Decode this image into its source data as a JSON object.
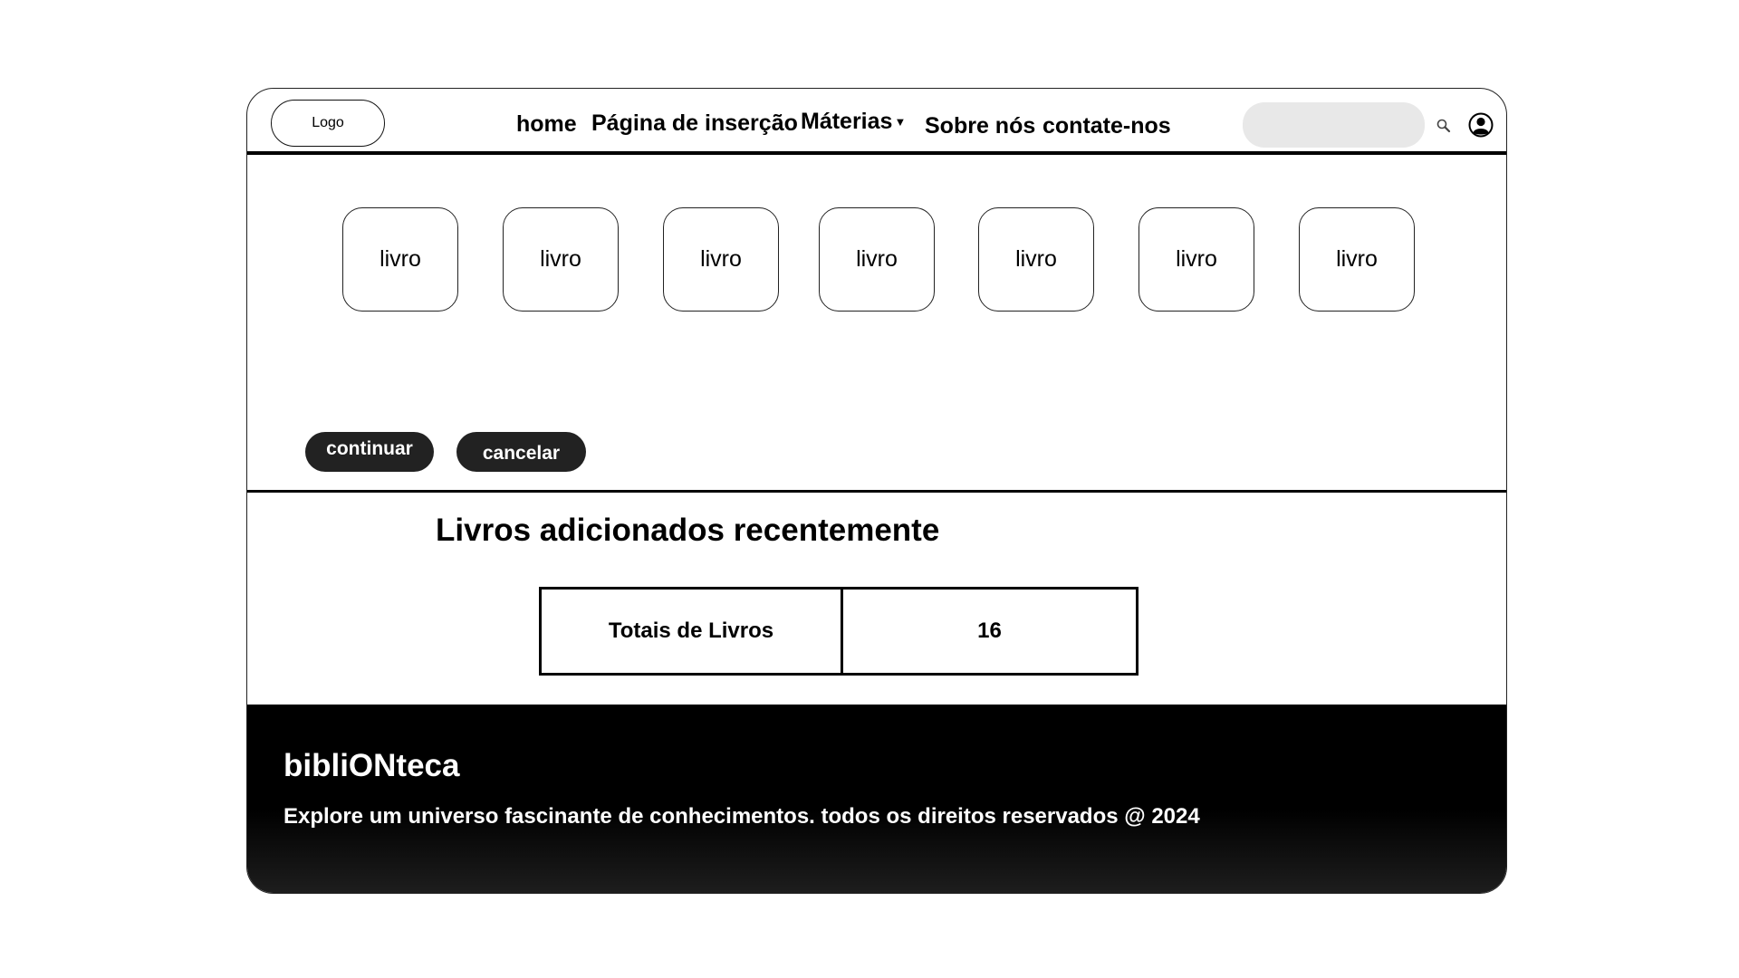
{
  "header": {
    "logo_label": "Logo",
    "nav": {
      "home": "home",
      "insert_page": "Página de inserção",
      "materias": "Máterias",
      "about": "Sobre nós",
      "contact": "contate-nos"
    },
    "search": {
      "value": "",
      "placeholder": ""
    }
  },
  "books": [
    "livro",
    "livro",
    "livro",
    "livro",
    "livro",
    "livro",
    "livro"
  ],
  "actions": {
    "continue_label": "continuar",
    "cancel_label": "cancelar"
  },
  "recent": {
    "title": "Livros adicionados recentemente",
    "stats": {
      "label": "Totais de Livros",
      "value": "16"
    }
  },
  "footer": {
    "brand": "bibliONteca",
    "tagline": "Explore um universo fascinante de conhecimentos. todos os direitos reservados @ 2024"
  },
  "colors": {
    "button_bg": "#222222",
    "search_bg": "#e8e8e8",
    "footer_bg": "#000000"
  },
  "icons": {
    "search": "search-icon",
    "user": "user-icon",
    "dropdown": "chevron-down-icon"
  }
}
